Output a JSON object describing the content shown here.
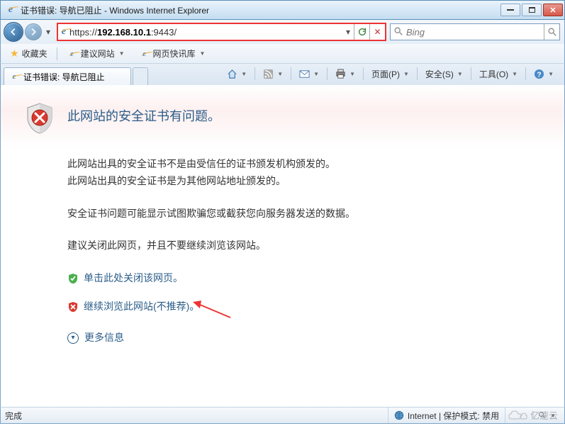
{
  "window": {
    "title": "证书错误: 导航已阻止 - Windows Internet Explorer"
  },
  "address": {
    "protocol": "https://",
    "host": "192.168.10.1",
    "port": ":9443/",
    "full": "https://192.168.10.1:9443/"
  },
  "search": {
    "placeholder": "Bing"
  },
  "favorites": {
    "label": "收藏夹",
    "suggested": "建议网站",
    "webslice": "网页快讯库"
  },
  "tab": {
    "title": "证书错误: 导航已阻止"
  },
  "toolbar": {
    "page": "页面(P)",
    "safety": "安全(S)",
    "tools": "工具(O)"
  },
  "cert": {
    "title": "此网站的安全证书有问题。",
    "line1": "此网站出具的安全证书不是由受信任的证书颁发机构颁发的。",
    "line2": "此网站出具的安全证书是为其他网站地址颁发的。",
    "warn": "安全证书问题可能显示试图欺骗您或截获您向服务器发送的数据。",
    "recommend": "建议关闭此网页，并且不要继续浏览该网站。",
    "close_link": "单击此处关闭该网页。",
    "continue_link": "继续浏览此网站(不推荐)。",
    "more_info": "更多信息"
  },
  "status": {
    "done": "完成",
    "zone": "Internet | 保护模式: 禁用"
  },
  "watermark": {
    "text": "亿速云"
  }
}
